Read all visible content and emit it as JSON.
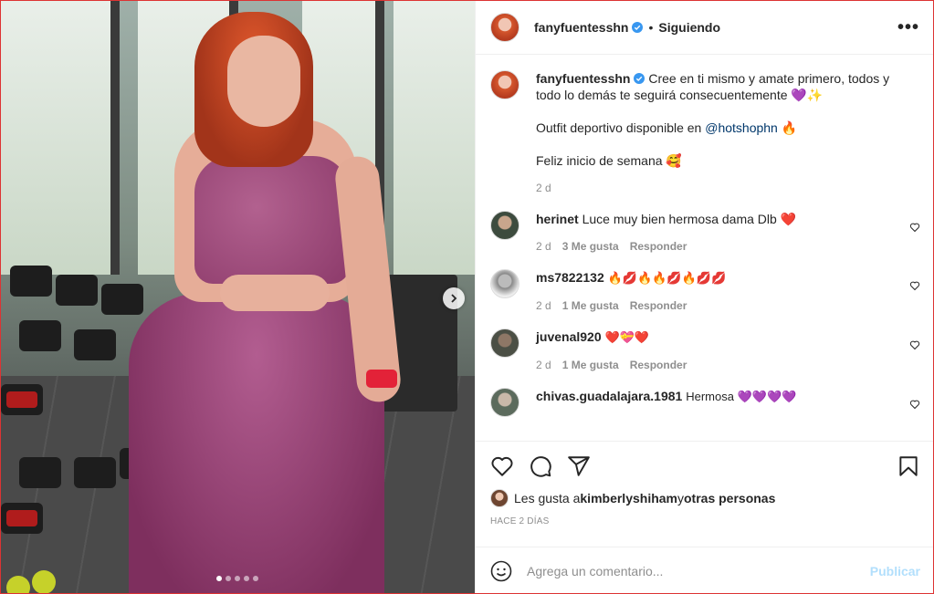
{
  "post": {
    "username": "fanyfuentesshn",
    "following_label": "Siguiendo",
    "more_label": "•••",
    "carousel": {
      "current": 1,
      "total": 5
    }
  },
  "caption": {
    "username": "fanyfuentesshn",
    "line1": "Cree en ti mismo y amate primero, todos y todo lo demás te seguirá consecuentemente 💜✨",
    "line2_prefix": "Outfit deportivo disponible en ",
    "line2_mention": "@hotshophn",
    "line2_suffix": " 🔥",
    "line3": "Feliz inicio de semana 🥰",
    "time": "2 d"
  },
  "comments": [
    {
      "username": "herinet",
      "text": "Luce muy bien hermosa dama Dlb ❤️",
      "time": "2 d",
      "likes": "3 Me gusta",
      "reply": "Responder"
    },
    {
      "username": "ms7822132",
      "text": "🔥💋🔥🔥💋🔥💋💋",
      "time": "2 d",
      "likes": "1 Me gusta",
      "reply": "Responder"
    },
    {
      "username": "juvenal920",
      "text": "❤️💝❤️",
      "time": "2 d",
      "likes": "1 Me gusta",
      "reply": "Responder"
    },
    {
      "username": "chivas.guadalajara.1981",
      "text": "Hermosa 💜💜💜💜",
      "time": "",
      "likes": "",
      "reply": ""
    }
  ],
  "likes": {
    "prefix": "Les gusta a ",
    "user": "kimberlyshiham",
    "middle": " y ",
    "others": "otras personas"
  },
  "posted_ago": "HACE 2 DÍAS",
  "comment_box": {
    "placeholder": "Agrega un comentario...",
    "publish_label": "Publicar"
  },
  "icons": {
    "verified": "verified-badge-icon",
    "heart": "heart-icon",
    "comment": "comment-icon",
    "share": "share-icon",
    "save": "bookmark-icon",
    "emoji": "emoji-icon",
    "next": "chevron-right-icon"
  }
}
